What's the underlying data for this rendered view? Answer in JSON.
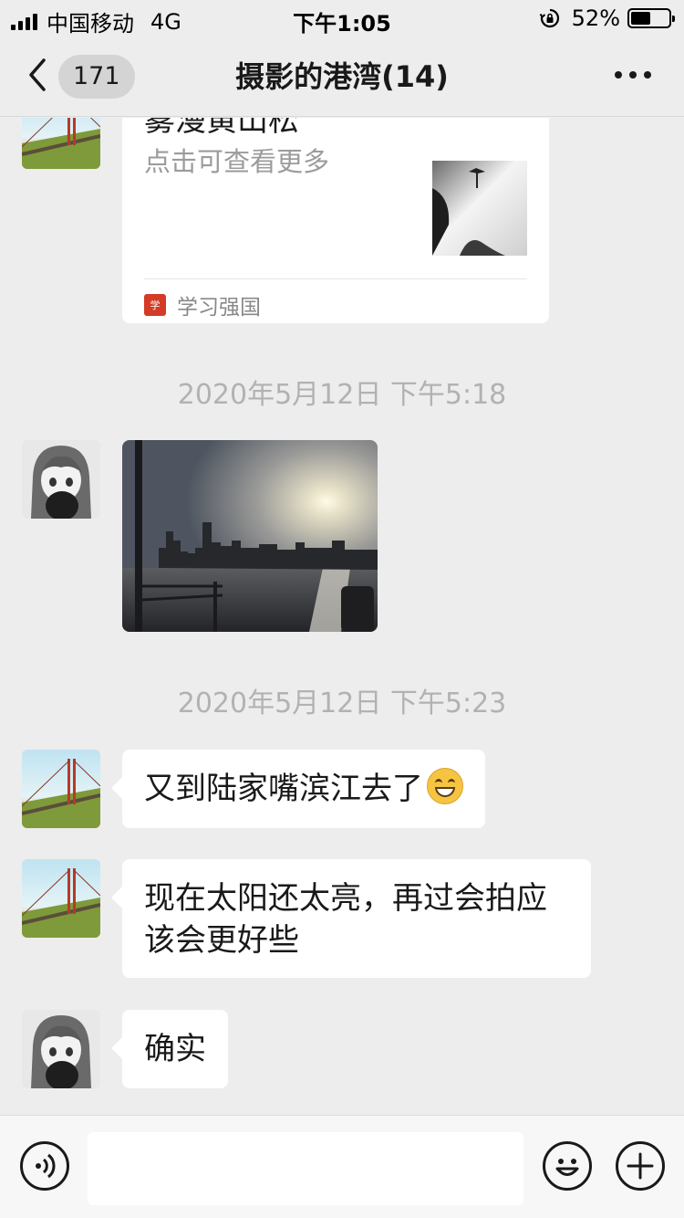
{
  "status_bar": {
    "carrier": "中国移动",
    "network": "4G",
    "time": "下午1:05",
    "battery_percent_text": "52%",
    "battery_level": 0.52
  },
  "nav": {
    "back_count": "171",
    "title": "摄影的港湾(14)"
  },
  "messages": {
    "card": {
      "title": "雾漫黄山松",
      "description": "点击可查看更多",
      "source": "学习强国"
    },
    "time1": "2020年5月12日 下午5:18",
    "time2": "2020年5月12日 下午5:23",
    "msg1": "又到陆家嘴滨江去了",
    "msg2": "现在太阳还太亮，再过会拍应该会更好些",
    "msg3": "确实"
  },
  "icons": {
    "back": "chevron-left-icon",
    "more": "more-dots-icon",
    "voice": "voice-icon",
    "emoji": "emoji-icon",
    "plus": "plus-icon"
  },
  "colors": {
    "background": "#ededed",
    "bubble": "#ffffff",
    "timestamp": "#b2b2b2",
    "source_brand": "#d33b26"
  }
}
